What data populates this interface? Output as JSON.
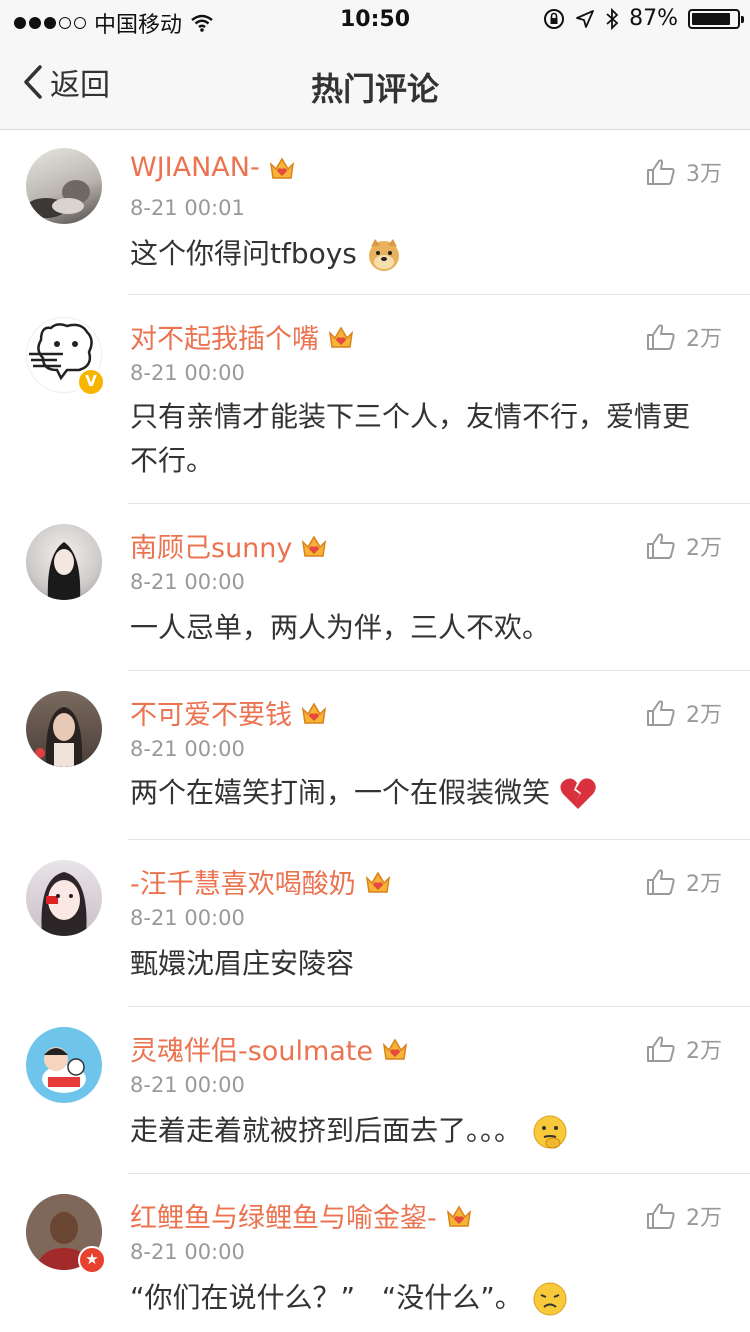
{
  "status_bar": {
    "carrier": "中国移动",
    "time": "10:50",
    "battery_percent": "87%",
    "battery_level": 0.87,
    "signal_dots_filled": 3,
    "signal_dots_total": 5
  },
  "nav": {
    "back_label": "返回",
    "title": "热门评论"
  },
  "colors": {
    "accent": "#eb7350",
    "secondary": "#999999",
    "text": "#333333"
  },
  "comments": [
    {
      "username": "WJIANAN-",
      "time": "8-21 00:01",
      "likes": "3万",
      "text": "这个你得问tfboys",
      "emoji": "doge-emoji",
      "avatar": "photo-avatar"
    },
    {
      "username": "对不起我插个嘴",
      "time": "8-21 00:00",
      "likes": "2万",
      "text": "只有亲情才能装下三个人，友情不行，爱情更不行。",
      "emoji": "",
      "avatar": "cartoon-bear-avatar",
      "verified": "V"
    },
    {
      "username": "南顾己sunny",
      "time": "8-21 00:00",
      "likes": "2万",
      "text": "一人忌单，两人为伴，三人不欢。",
      "emoji": "",
      "avatar": "photo-avatar"
    },
    {
      "username": "不可爱不要钱",
      "time": "8-21 00:00",
      "likes": "2万",
      "text": "两个在嬉笑打闹，一个在假装微笑",
      "emoji": "broken-heart-emoji",
      "avatar": "photo-avatar"
    },
    {
      "username": "-汪千慧喜欢喝酸奶",
      "time": "8-21 00:00",
      "likes": "2万",
      "text": "甄嬛沈眉庄安陵容",
      "emoji": "",
      "avatar": "photo-avatar"
    },
    {
      "username": "灵魂伴侣-soulmate",
      "time": "8-21 00:00",
      "likes": "2万",
      "text": "走着走着就被挤到后面去了。。。",
      "emoji": "thinking-face-emoji",
      "avatar": "cartoon-avatar"
    },
    {
      "username": "红鲤鱼与绿鲤鱼与喻金鋆-",
      "time": "8-21 00:00",
      "likes": "2万",
      "text": "“你们在说什么？”   “没什么”。",
      "emoji": "sad-face-emoji",
      "avatar": "photo-avatar",
      "verified": "★"
    }
  ]
}
